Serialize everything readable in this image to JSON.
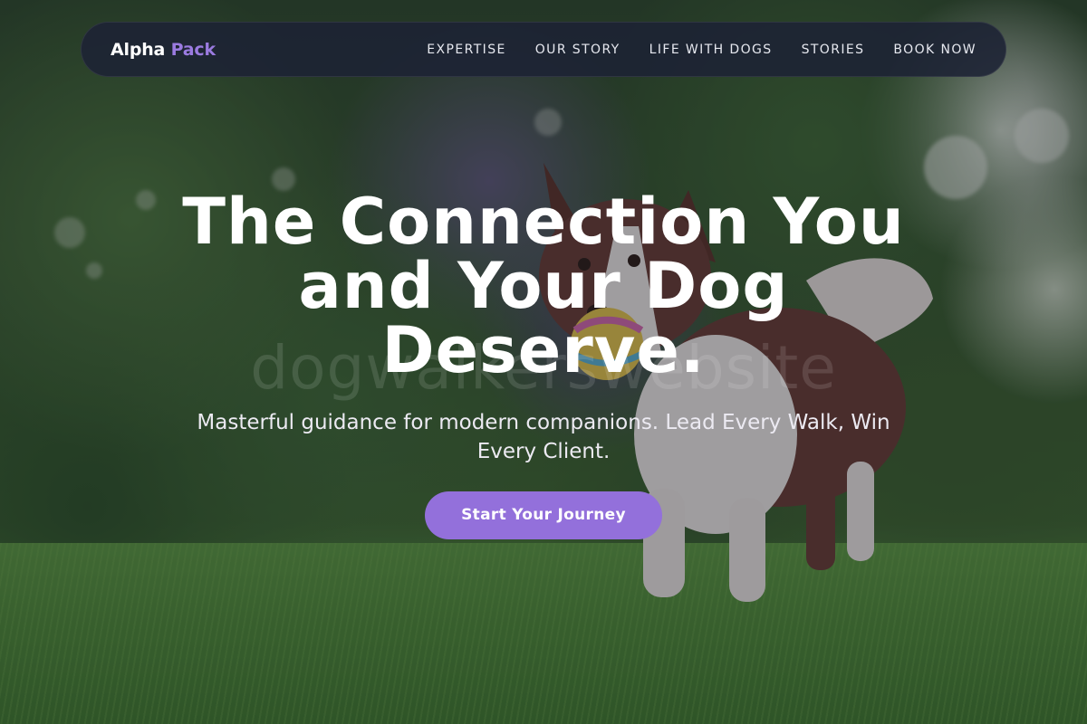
{
  "brand": {
    "name_primary": "Alpha",
    "name_accent": "Pack"
  },
  "nav": {
    "items": [
      {
        "label": "EXPERTISE"
      },
      {
        "label": "OUR STORY"
      },
      {
        "label": "LIFE WITH DOGS"
      },
      {
        "label": "STORIES"
      },
      {
        "label": "BOOK NOW"
      }
    ]
  },
  "hero": {
    "title": "The Connection You and Your Dog Deserve.",
    "subtitle": "Masterful guidance for modern companions. Lead Every Walk, Win Every Client.",
    "cta_label": "Start Your Journey",
    "background_image": "border-collie-with-ball-in-garden",
    "watermark": "dogwalkerswebsite"
  },
  "colors": {
    "accent": "#9370DB",
    "nav_background": "#1C2234",
    "text": "#FFFFFF"
  }
}
